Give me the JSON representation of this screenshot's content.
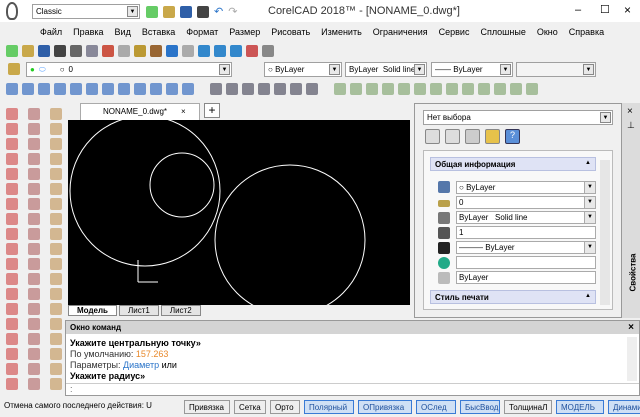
{
  "window": {
    "title": "CorelCAD 2018™ - [NONAME_0.dwg*]",
    "workspace": "Classic",
    "min": "–",
    "max": "☐",
    "close": "×"
  },
  "menu": [
    "Файл",
    "Правка",
    "Вид",
    "Вставка",
    "Формат",
    "Размер",
    "Рисовать",
    "Изменить",
    "Ограничения",
    "Сервис",
    "Сплошные",
    "Окно",
    "Справка"
  ],
  "layer": {
    "value": "0",
    "color": "ByLayer",
    "linetype_name": "ByLayer",
    "linetype": "Solid line",
    "lineweight": "ByLayer"
  },
  "doc_tab": {
    "label": "NONAME_0.dwg*",
    "close": "×",
    "add": "+"
  },
  "layout_tabs": [
    "Модель",
    "Лист1",
    "Лист2"
  ],
  "properties": {
    "selection": "Нет выбора",
    "section1": "Общая информация",
    "color": "ByLayer",
    "layer": "0",
    "linetype_name": "ByLayer",
    "linetype": "Solid line",
    "scale": "1",
    "lineweight": "ByLayer",
    "hyperlink": "",
    "transparency": "ByLayer",
    "section2": "Стиль печати",
    "side_label": "Свойства"
  },
  "command": {
    "title": "Окно команд",
    "close": "×",
    "lines": [
      "Укажите центральную точку»",
      "По умолчанию: ",
      "157.263",
      "Параметры: ",
      "Диаметр",
      " или",
      "Укажите радиус»"
    ],
    "prompt": ":"
  },
  "status": {
    "message": "Отмена самого последнего действия: U",
    "buttons": [
      {
        "label": "Привязка",
        "on": false
      },
      {
        "label": "Сетка",
        "on": false
      },
      {
        "label": "Орто",
        "on": false
      },
      {
        "label": "Полярный",
        "on": true
      },
      {
        "label": "ОПривязка",
        "on": true
      },
      {
        "label": "ОСлед",
        "on": true
      },
      {
        "label": "БысВвод",
        "on": true
      },
      {
        "label": "ТолщинаЛ",
        "on": false
      },
      {
        "label": "МОДЕЛЬ",
        "on": true
      },
      {
        "label": "Динамиче",
        "on": true
      }
    ]
  },
  "colors": {
    "accent": "#3a7bd5",
    "value": "#e8892b",
    "link": "#2a74c9"
  }
}
